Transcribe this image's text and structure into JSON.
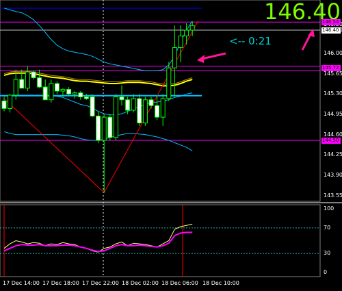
{
  "chart_data": {
    "type": "candlestick",
    "symbol_quote": "146.40",
    "countdown": "<-- 0:21",
    "price_axis": [
      "146.50",
      "146.40",
      "146.00",
      "145.65",
      "145.30",
      "144.95",
      "144.60",
      "144.25",
      "143.90",
      "143.55"
    ],
    "price_tags": {
      "upper_band": "146.54",
      "current": "146.40",
      "middle": "145.72",
      "lower_band": "144.50"
    },
    "indicator_axis": [
      "100",
      "70",
      "30",
      "0"
    ],
    "indicator_levels": [
      70,
      30
    ],
    "time_axis": [
      "17 Dec 14:00",
      "17 Dec 18:00",
      "17 Dec 22:00",
      "18 Dec 02:00",
      "18 Dec 06:00",
      "18 Dec 10:00"
    ],
    "colors": {
      "background": "#000000",
      "bull_candle": "#000000",
      "bear_candle": "#ffffff",
      "wick": "#00ff00",
      "yellow_ma": "#ffff00",
      "cyan_band": "#00bfff",
      "blue_band": "#0000ff",
      "magenta_lines": "#ff00ff",
      "red_line": "#ff0000",
      "arrow": "#ff1493",
      "price_text": "#7CFC00",
      "timer_text": "#00CED1"
    },
    "candles": [
      {
        "o": 145.18,
        "h": 145.25,
        "l": 145.0,
        "c": 145.05
      },
      {
        "o": 145.05,
        "h": 145.3,
        "l": 144.98,
        "c": 145.28
      },
      {
        "o": 145.28,
        "h": 145.72,
        "l": 145.2,
        "c": 145.55
      },
      {
        "o": 145.55,
        "h": 145.72,
        "l": 145.4,
        "c": 145.4
      },
      {
        "o": 145.4,
        "h": 145.78,
        "l": 145.35,
        "c": 145.68
      },
      {
        "o": 145.68,
        "h": 145.7,
        "l": 145.55,
        "c": 145.58
      },
      {
        "o": 145.58,
        "h": 145.72,
        "l": 145.4,
        "c": 145.42
      },
      {
        "o": 145.42,
        "h": 145.55,
        "l": 145.2,
        "c": 145.2
      },
      {
        "o": 145.2,
        "h": 145.55,
        "l": 145.15,
        "c": 145.48
      },
      {
        "o": 145.48,
        "h": 145.52,
        "l": 145.3,
        "c": 145.35
      },
      {
        "o": 145.35,
        "h": 145.4,
        "l": 145.25,
        "c": 145.38
      },
      {
        "o": 145.38,
        "h": 145.42,
        "l": 145.28,
        "c": 145.3
      },
      {
        "o": 145.3,
        "h": 145.35,
        "l": 145.22,
        "c": 145.32
      },
      {
        "o": 145.32,
        "h": 145.35,
        "l": 145.2,
        "c": 145.25
      },
      {
        "o": 145.25,
        "h": 145.3,
        "l": 145.2,
        "c": 145.22
      },
      {
        "o": 145.25,
        "h": 145.3,
        "l": 144.9,
        "c": 144.92
      },
      {
        "o": 144.92,
        "h": 145.0,
        "l": 144.45,
        "c": 144.5
      },
      {
        "o": 144.5,
        "h": 144.95,
        "l": 143.6,
        "c": 144.9
      },
      {
        "o": 144.9,
        "h": 144.95,
        "l": 144.5,
        "c": 144.55
      },
      {
        "o": 144.55,
        "h": 145.3,
        "l": 144.5,
        "c": 145.25
      },
      {
        "o": 145.25,
        "h": 145.45,
        "l": 145.1,
        "c": 145.2
      },
      {
        "o": 145.2,
        "h": 145.25,
        "l": 144.95,
        "c": 145.02
      },
      {
        "o": 145.02,
        "h": 145.3,
        "l": 144.98,
        "c": 145.22
      },
      {
        "o": 145.22,
        "h": 145.3,
        "l": 144.75,
        "c": 144.8
      },
      {
        "o": 144.8,
        "h": 145.25,
        "l": 144.75,
        "c": 145.2
      },
      {
        "o": 145.2,
        "h": 145.25,
        "l": 145.05,
        "c": 145.1
      },
      {
        "o": 145.1,
        "h": 145.28,
        "l": 144.85,
        "c": 144.9
      },
      {
        "o": 144.9,
        "h": 145.3,
        "l": 144.75,
        "c": 145.22
      },
      {
        "o": 145.22,
        "h": 145.85,
        "l": 145.18,
        "c": 145.75
      },
      {
        "o": 145.75,
        "h": 146.48,
        "l": 145.25,
        "c": 146.1
      },
      {
        "o": 146.1,
        "h": 146.48,
        "l": 145.85,
        "c": 146.3
      },
      {
        "o": 146.3,
        "h": 146.52,
        "l": 146.15,
        "c": 146.4
      },
      {
        "o": 146.4,
        "h": 146.55,
        "l": 146.3,
        "c": 146.48
      }
    ],
    "yellow_ma": [
      145.62,
      145.65,
      145.66,
      145.66,
      145.66,
      145.65,
      145.63,
      145.61,
      145.59,
      145.58,
      145.57,
      145.55,
      145.53,
      145.52,
      145.52,
      145.51,
      145.5,
      145.49,
      145.48,
      145.48,
      145.49,
      145.5,
      145.5,
      145.5,
      145.49,
      145.48,
      145.46,
      145.44,
      145.44,
      145.45,
      145.48,
      145.52,
      145.55
    ],
    "band_mid": [
      145.26,
      145.28,
      145.28,
      145.28,
      145.28,
      145.28,
      145.28,
      145.27,
      145.27,
      145.26,
      145.24,
      145.2,
      145.16,
      145.12,
      145.1,
      145.06,
      145.0,
      144.96,
      144.94,
      144.94,
      144.96,
      145.0,
      145.04,
      145.08,
      145.12,
      145.15,
      145.16,
      145.18,
      145.2,
      145.24,
      145.26,
      145.3,
      145.32
    ],
    "band_low": [
      144.65,
      144.62,
      144.6,
      144.6,
      144.6,
      144.6,
      144.6,
      144.6,
      144.6,
      144.6,
      144.59,
      144.58,
      144.56,
      144.53,
      144.51,
      144.5,
      144.5,
      144.52,
      144.55,
      144.58,
      144.6,
      144.62,
      144.62,
      144.61,
      144.6,
      144.58,
      144.56,
      144.53,
      144.5,
      144.46,
      144.42,
      144.38,
      144.32
    ],
    "band_up": [
      146.78,
      146.75,
      146.72,
      146.7,
      146.65,
      146.58,
      146.48,
      146.36,
      146.24,
      146.14,
      146.08,
      146.04,
      146.02,
      146.0,
      145.98,
      145.95,
      145.9,
      145.85,
      145.82,
      145.8,
      145.78,
      145.76,
      145.74,
      145.72,
      145.7,
      145.7,
      145.7,
      145.72,
      145.8,
      145.95,
      146.2,
      146.4,
      146.56
    ],
    "indicator_yellow": [
      38,
      45,
      50,
      48,
      45,
      47,
      46,
      42,
      45,
      44,
      47,
      45,
      44,
      40,
      38,
      34,
      32,
      38,
      40,
      45,
      48,
      42,
      46,
      45,
      44,
      42,
      40,
      45,
      50,
      68,
      72,
      74,
      76
    ],
    "indicator_magenta": [
      34,
      38,
      42,
      44,
      43,
      43,
      44,
      42,
      42,
      42,
      43,
      43,
      42,
      40,
      38,
      35,
      33,
      34,
      38,
      42,
      44,
      42,
      42,
      43,
      42,
      41,
      40,
      42,
      46,
      58,
      62,
      63,
      63
    ]
  }
}
